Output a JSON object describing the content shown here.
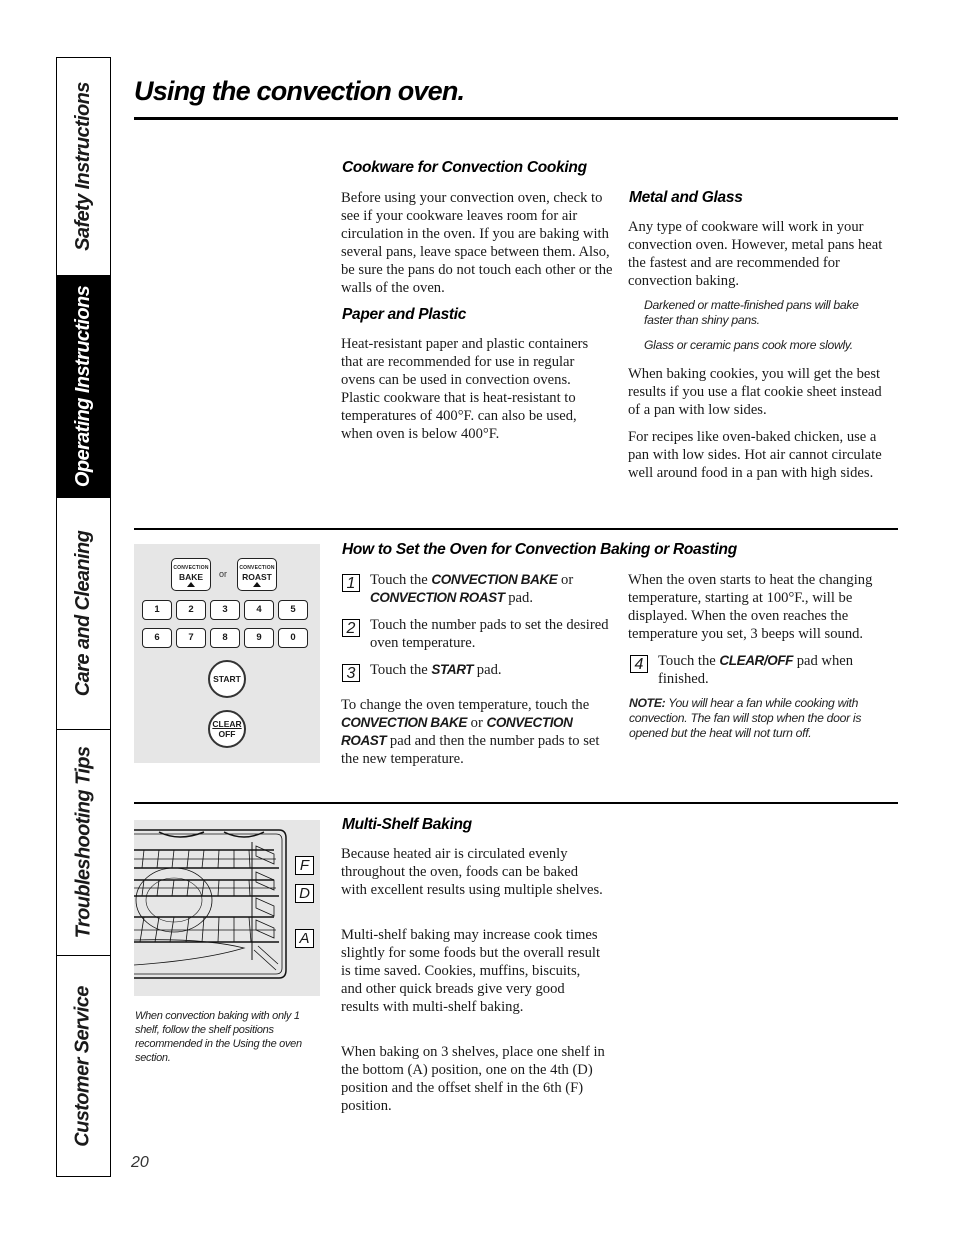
{
  "side_tabs": [
    {
      "label": "Safety Instructions",
      "active": false
    },
    {
      "label": "Operating Instructions",
      "active": true
    },
    {
      "label": "Care and Cleaning",
      "active": false
    },
    {
      "label": "Troubleshooting Tips",
      "active": false
    },
    {
      "label": "Customer Service",
      "active": false
    }
  ],
  "page_title": "Using the convection oven.",
  "cookware": {
    "heading": "Cookware for Convection Cooking",
    "body": "Before using your convection oven, check to see if your cookware leaves room for air circulation in the oven. If you are baking with several pans, leave space between them. Also, be sure the pans do not touch each other or the walls of the oven."
  },
  "paper_plastic": {
    "heading": "Paper and Plastic",
    "body": "Heat-resistant paper and plastic containers that are recommended for use in regular ovens can be used in convection ovens. Plastic cookware that is heat-resistant to temperatures of 400°F. can also be used, when oven is below 400°F."
  },
  "metal_glass": {
    "heading": "Metal and Glass",
    "body": "Any type of cookware will work in your convection oven. However, metal pans heat the fastest and are recommended for convection baking.",
    "note1": "Darkened or matte-finished pans will bake faster than shiny pans.",
    "note2": "Glass or ceramic pans cook more slowly.",
    "cookies": "When baking cookies, you will get the best results if you use a flat cookie sheet instead of a pan with low sides.",
    "chicken": "For recipes like oven-baked chicken, use a pan with low sides. Hot air cannot circulate well around food in a pan with high sides."
  },
  "control_panel": {
    "bake_small": "CONVECTION",
    "bake_big": "BAKE",
    "or": "or",
    "roast_small": "CONVECTION",
    "roast_big": "ROAST",
    "numbers": [
      "1",
      "2",
      "3",
      "4",
      "5",
      "6",
      "7",
      "8",
      "9",
      "0"
    ],
    "start": "START",
    "clear": "CLEAR",
    "off": "OFF"
  },
  "how_to": {
    "heading": "How to Set the Oven for Convection Baking or Roasting",
    "steps": [
      {
        "num": "1",
        "pre": "Touch the ",
        "kw1": "CONVECTION BAKE",
        "mid": " or ",
        "kw2": "CONVECTION ROAST",
        "post": " pad."
      },
      {
        "num": "2",
        "text": "Touch the number pads to set the desired oven temperature."
      },
      {
        "num": "3",
        "pre": "Touch the ",
        "kw1": "START",
        "post": " pad."
      },
      {
        "num": "4",
        "pre": "Touch the ",
        "kw1": "CLEAR/OFF",
        "post": " pad when finished."
      }
    ],
    "change_pre": "To change the oven temperature, touch the ",
    "change_kw1": "CONVECTION BAKE",
    "change_mid": " or ",
    "change_kw2": "CONVECTION ROAST",
    "change_post": " pad and then the number pads to set the new temperature.",
    "heating": "When the oven starts to heat the changing temperature, starting at 100°F., will be displayed. When the oven reaches the temperature you set, 3 beeps will sound.",
    "note_label": "NOTE:",
    "note_text": " You will hear a fan while cooking with convection. The fan will stop when the door is opened but the heat will not turn off."
  },
  "multi_shelf": {
    "heading": "Multi-Shelf Baking",
    "p1": "Because heated air is circulated evenly throughout the oven, foods can be baked with excellent results using multiple shelves.",
    "p2": "Multi-shelf baking may increase cook times slightly for some foods but the overall result is time saved. Cookies, muffins, biscuits, and other quick breads give very good results with multi-shelf baking.",
    "p3": "When baking on 3 shelves, place one shelf in the bottom (A) position, one on the 4th (D) position and the offset shelf in the 6th (F) position.",
    "shelf_labels": [
      "F",
      "D",
      "A"
    ],
    "caption": "When convection baking with only 1 shelf, follow the shelf positions recommended in the Using the oven section."
  },
  "page_number": "20"
}
